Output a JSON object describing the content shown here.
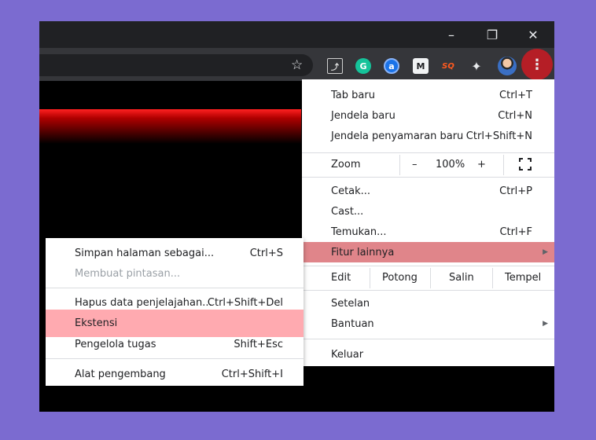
{
  "window_controls": {
    "minimize": "–",
    "restore": "❐",
    "close": "✕"
  },
  "toolbar": {
    "extensions": [
      "pdf-icon",
      "grammarly-icon",
      "a-icon",
      "m-icon",
      "sq-icon",
      "puzzle-icon",
      "avatar"
    ],
    "menu_icon": "⋮",
    "ext_labels": {
      "grammarly": "G",
      "a": "a",
      "m": "M",
      "sq": "SQ"
    },
    "star": "☆",
    "puzzle": "✦",
    "pdf": "⤴"
  },
  "main_menu": {
    "new_tab": {
      "label": "Tab baru",
      "shortcut": "Ctrl+T"
    },
    "new_window": {
      "label": "Jendela baru",
      "shortcut": "Ctrl+N"
    },
    "incognito": {
      "label": "Jendela penyamaran baru",
      "shortcut": "Ctrl+Shift+N"
    },
    "zoom": {
      "label": "Zoom",
      "minus": "–",
      "level": "100%",
      "plus": "+"
    },
    "print": {
      "label": "Cetak...",
      "shortcut": "Ctrl+P"
    },
    "cast": {
      "label": "Cast..."
    },
    "find": {
      "label": "Temukan...",
      "shortcut": "Ctrl+F"
    },
    "more_tools": {
      "label": "Fitur lainnya",
      "arrow": "▶"
    },
    "edit": {
      "label": "Edit",
      "cut": "Potong",
      "copy": "Salin",
      "paste": "Tempel"
    },
    "settings": {
      "label": "Setelan"
    },
    "help": {
      "label": "Bantuan",
      "arrow": "▶"
    },
    "exit": {
      "label": "Keluar"
    }
  },
  "sub_menu": {
    "save_page": {
      "label": "Simpan halaman sebagai...",
      "shortcut": "Ctrl+S"
    },
    "create_shortcut": {
      "label": "Membuat pintasan..."
    },
    "clear_data": {
      "label": "Hapus data penjelajahan...",
      "shortcut": "Ctrl+Shift+Del"
    },
    "extensions": {
      "label": "Ekstensi"
    },
    "task_manager": {
      "label": "Pengelola tugas",
      "shortcut": "Shift+Esc"
    },
    "dev_tools": {
      "label": "Alat pengembang",
      "shortcut": "Ctrl+Shift+I"
    }
  },
  "colors": {
    "background": "#7b6bd0",
    "highlight_main": "#e0858a",
    "highlight_sub": "#ffaab0",
    "menu_button": "#b51e26"
  }
}
